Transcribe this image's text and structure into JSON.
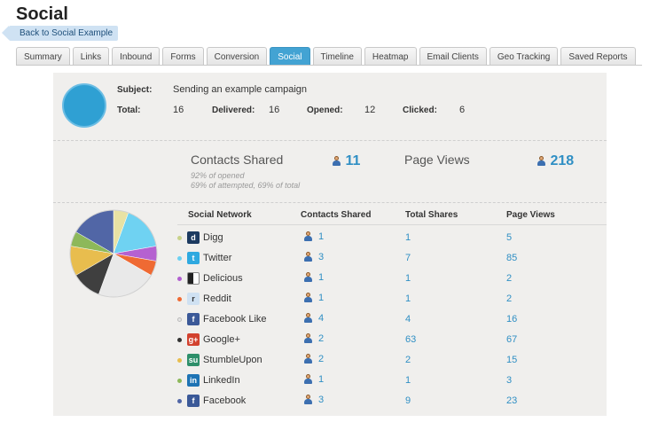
{
  "page": {
    "title": "Social",
    "back_link": "Back to Social Example"
  },
  "tabs": [
    {
      "label": "Summary",
      "active": false
    },
    {
      "label": "Links",
      "active": false
    },
    {
      "label": "Inbound",
      "active": false
    },
    {
      "label": "Forms",
      "active": false
    },
    {
      "label": "Conversion",
      "active": false
    },
    {
      "label": "Social",
      "active": true
    },
    {
      "label": "Timeline",
      "active": false
    },
    {
      "label": "Heatmap",
      "active": false
    },
    {
      "label": "Email Clients",
      "active": false
    },
    {
      "label": "Geo Tracking",
      "active": false
    },
    {
      "label": "Saved Reports",
      "active": false
    }
  ],
  "summary": {
    "subject_label": "Subject:",
    "subject_value": "Sending an example campaign",
    "total_label": "Total:",
    "total_value": "16",
    "delivered_label": "Delivered:",
    "delivered_value": "16",
    "opened_label": "Opened:",
    "opened_value": "12",
    "clicked_label": "Clicked:",
    "clicked_value": "6"
  },
  "stats": {
    "contacts_shared_label": "Contacts Shared",
    "contacts_shared_value": "11",
    "note_opened": "92% of opened",
    "note_attempted": "69% of attempted, 69% of total",
    "page_views_label": "Page Views",
    "page_views_value": "218"
  },
  "table": {
    "headers": {
      "network": "Social Network",
      "contacts_shared": "Contacts Shared",
      "total_shares": "Total Shares",
      "page_views": "Page Views"
    },
    "rows": [
      {
        "network": "Digg",
        "icon": "digg-icon",
        "dot_color": "#c8d28a",
        "icon_color": "#1c3a60",
        "glyph": "d",
        "contacts_shared": "1",
        "total_shares": "1",
        "page_views": "5"
      },
      {
        "network": "Twitter",
        "icon": "twitter-icon",
        "dot_color": "#6cd1f2",
        "icon_color": "#2fa9e0",
        "glyph": "t",
        "contacts_shared": "3",
        "total_shares": "7",
        "page_views": "85"
      },
      {
        "network": "Delicious",
        "icon": "delicious-icon",
        "dot_color": "#b25fd0",
        "icon_color": "#333333",
        "glyph": "",
        "contacts_shared": "1",
        "total_shares": "1",
        "page_views": "2"
      },
      {
        "network": "Reddit",
        "icon": "reddit-icon",
        "dot_color": "#ef6a33",
        "icon_color": "#cfe1f2",
        "glyph": "r",
        "contacts_shared": "1",
        "total_shares": "1",
        "page_views": "2"
      },
      {
        "network": "Facebook Like",
        "icon": "facebook-like-icon",
        "dot_color": "#e6e6e6",
        "icon_color": "#3b5998",
        "glyph": "f",
        "contacts_shared": "4",
        "total_shares": "4",
        "page_views": "16"
      },
      {
        "network": "Google+",
        "icon": "google-plus-icon",
        "dot_color": "#333333",
        "icon_color": "#d2412e",
        "glyph": "g+",
        "contacts_shared": "2",
        "total_shares": "63",
        "page_views": "67"
      },
      {
        "network": "StumbleUpon",
        "icon": "stumbleupon-icon",
        "dot_color": "#e8bd4e",
        "icon_color": "#2d8f6a",
        "glyph": "su",
        "contacts_shared": "2",
        "total_shares": "2",
        "page_views": "15"
      },
      {
        "network": "LinkedIn",
        "icon": "linkedin-icon",
        "dot_color": "#8db85a",
        "icon_color": "#1e73b4",
        "glyph": "in",
        "contacts_shared": "1",
        "total_shares": "1",
        "page_views": "3"
      },
      {
        "network": "Facebook",
        "icon": "facebook-icon",
        "dot_color": "#5166a6",
        "icon_color": "#3b5998",
        "glyph": "f",
        "contacts_shared": "3",
        "total_shares": "9",
        "page_views": "23"
      }
    ]
  },
  "pie": {
    "slices": [
      {
        "name": "Digg",
        "value": 1,
        "color": "#e8e2a4"
      },
      {
        "name": "Twitter",
        "value": 3,
        "color": "#6fd2f2"
      },
      {
        "name": "Delicious",
        "value": 1,
        "color": "#b561d0"
      },
      {
        "name": "Reddit",
        "value": 1,
        "color": "#ef6a33"
      },
      {
        "name": "Facebook Like",
        "value": 4,
        "color": "#e9e9e9"
      },
      {
        "name": "Google+",
        "value": 2,
        "color": "#3f3f3f"
      },
      {
        "name": "StumbleUpon",
        "value": 2,
        "color": "#e8bd4e"
      },
      {
        "name": "LinkedIn",
        "value": 1,
        "color": "#8db85a"
      },
      {
        "name": "Facebook",
        "value": 3,
        "color": "#5166a6"
      }
    ]
  }
}
